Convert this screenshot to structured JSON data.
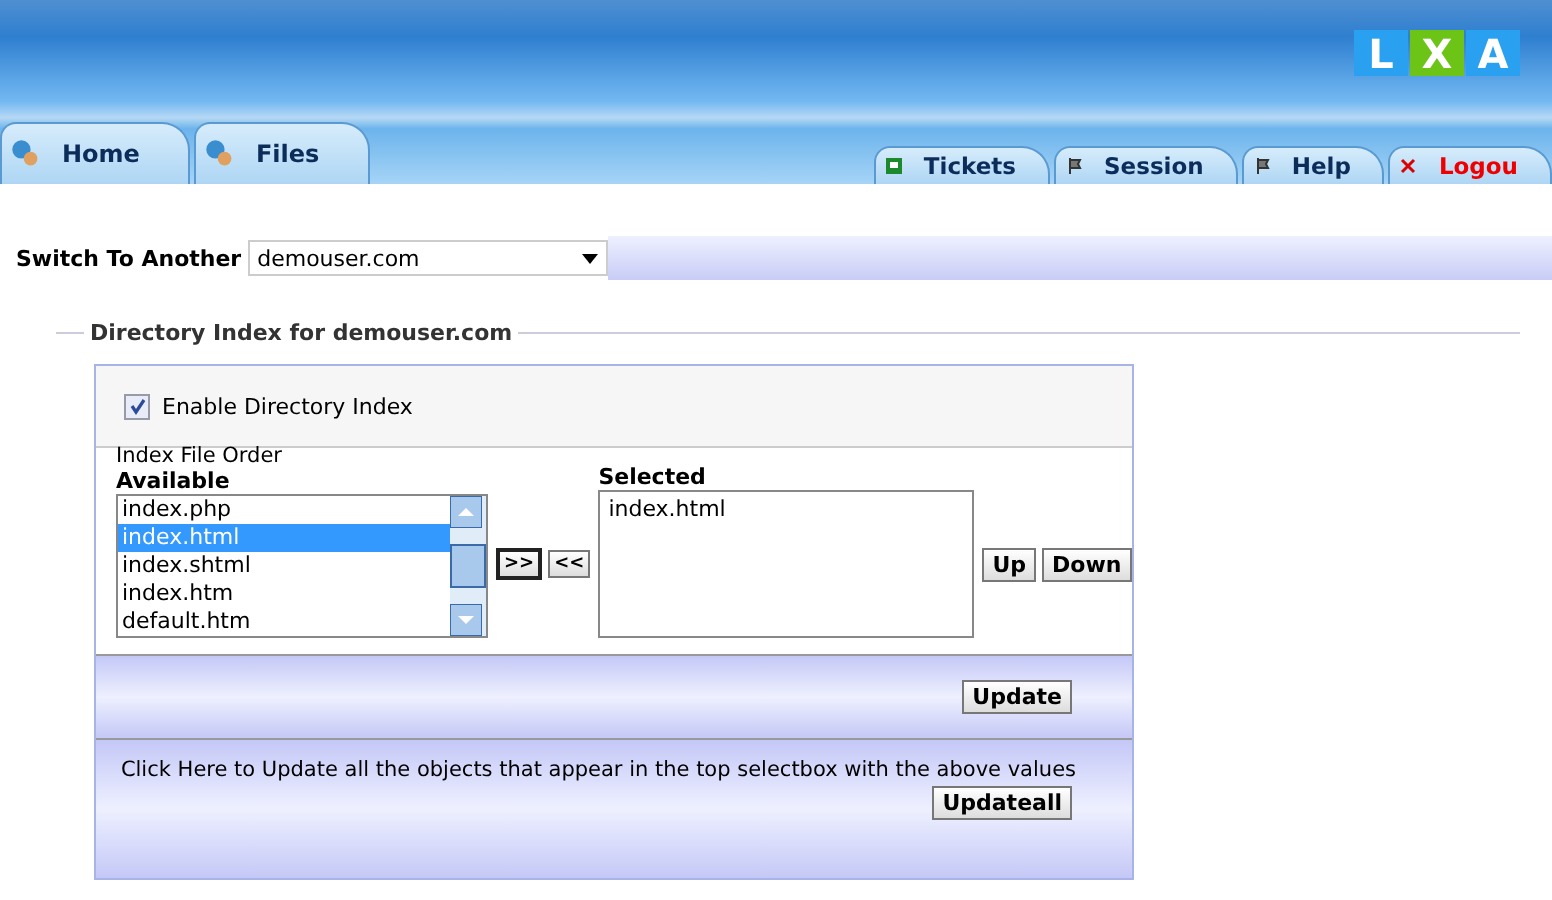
{
  "logo": [
    "L",
    "X",
    "A"
  ],
  "left_tabs": [
    {
      "label": "Home",
      "selected": false
    },
    {
      "label": "Files",
      "selected": false
    }
  ],
  "right_tabs": [
    {
      "label": "Tickets",
      "kind": "ticket",
      "selected": false
    },
    {
      "label": "Session",
      "kind": "flag",
      "selected": false
    },
    {
      "label": "Help",
      "kind": "flag",
      "selected": false
    },
    {
      "label": "Logou",
      "kind": "logout",
      "selected": false
    }
  ],
  "switch": {
    "label": "Switch To Another",
    "value": "demouser.com"
  },
  "section_title": "Directory Index for demouser.com",
  "enable": {
    "label": "Enable Directory Index",
    "checked": true
  },
  "order_label": "Index File Order",
  "available": {
    "title": "Available",
    "items": [
      {
        "label": "index.php",
        "selected": false
      },
      {
        "label": "index.html",
        "selected": true
      },
      {
        "label": "index.shtml",
        "selected": false
      },
      {
        "label": "index.htm",
        "selected": false
      },
      {
        "label": "default.htm",
        "selected": false
      }
    ]
  },
  "move_buttons": [
    ">>",
    "<<"
  ],
  "selected_list": {
    "title": "Selected",
    "items": [
      "index.html"
    ]
  },
  "order_buttons": [
    "Up",
    "Down"
  ],
  "update_button": "Update",
  "update_all": {
    "text": "Click Here to Update all the objects that appear in the top selectbox with the above values",
    "button": "Updateall"
  }
}
